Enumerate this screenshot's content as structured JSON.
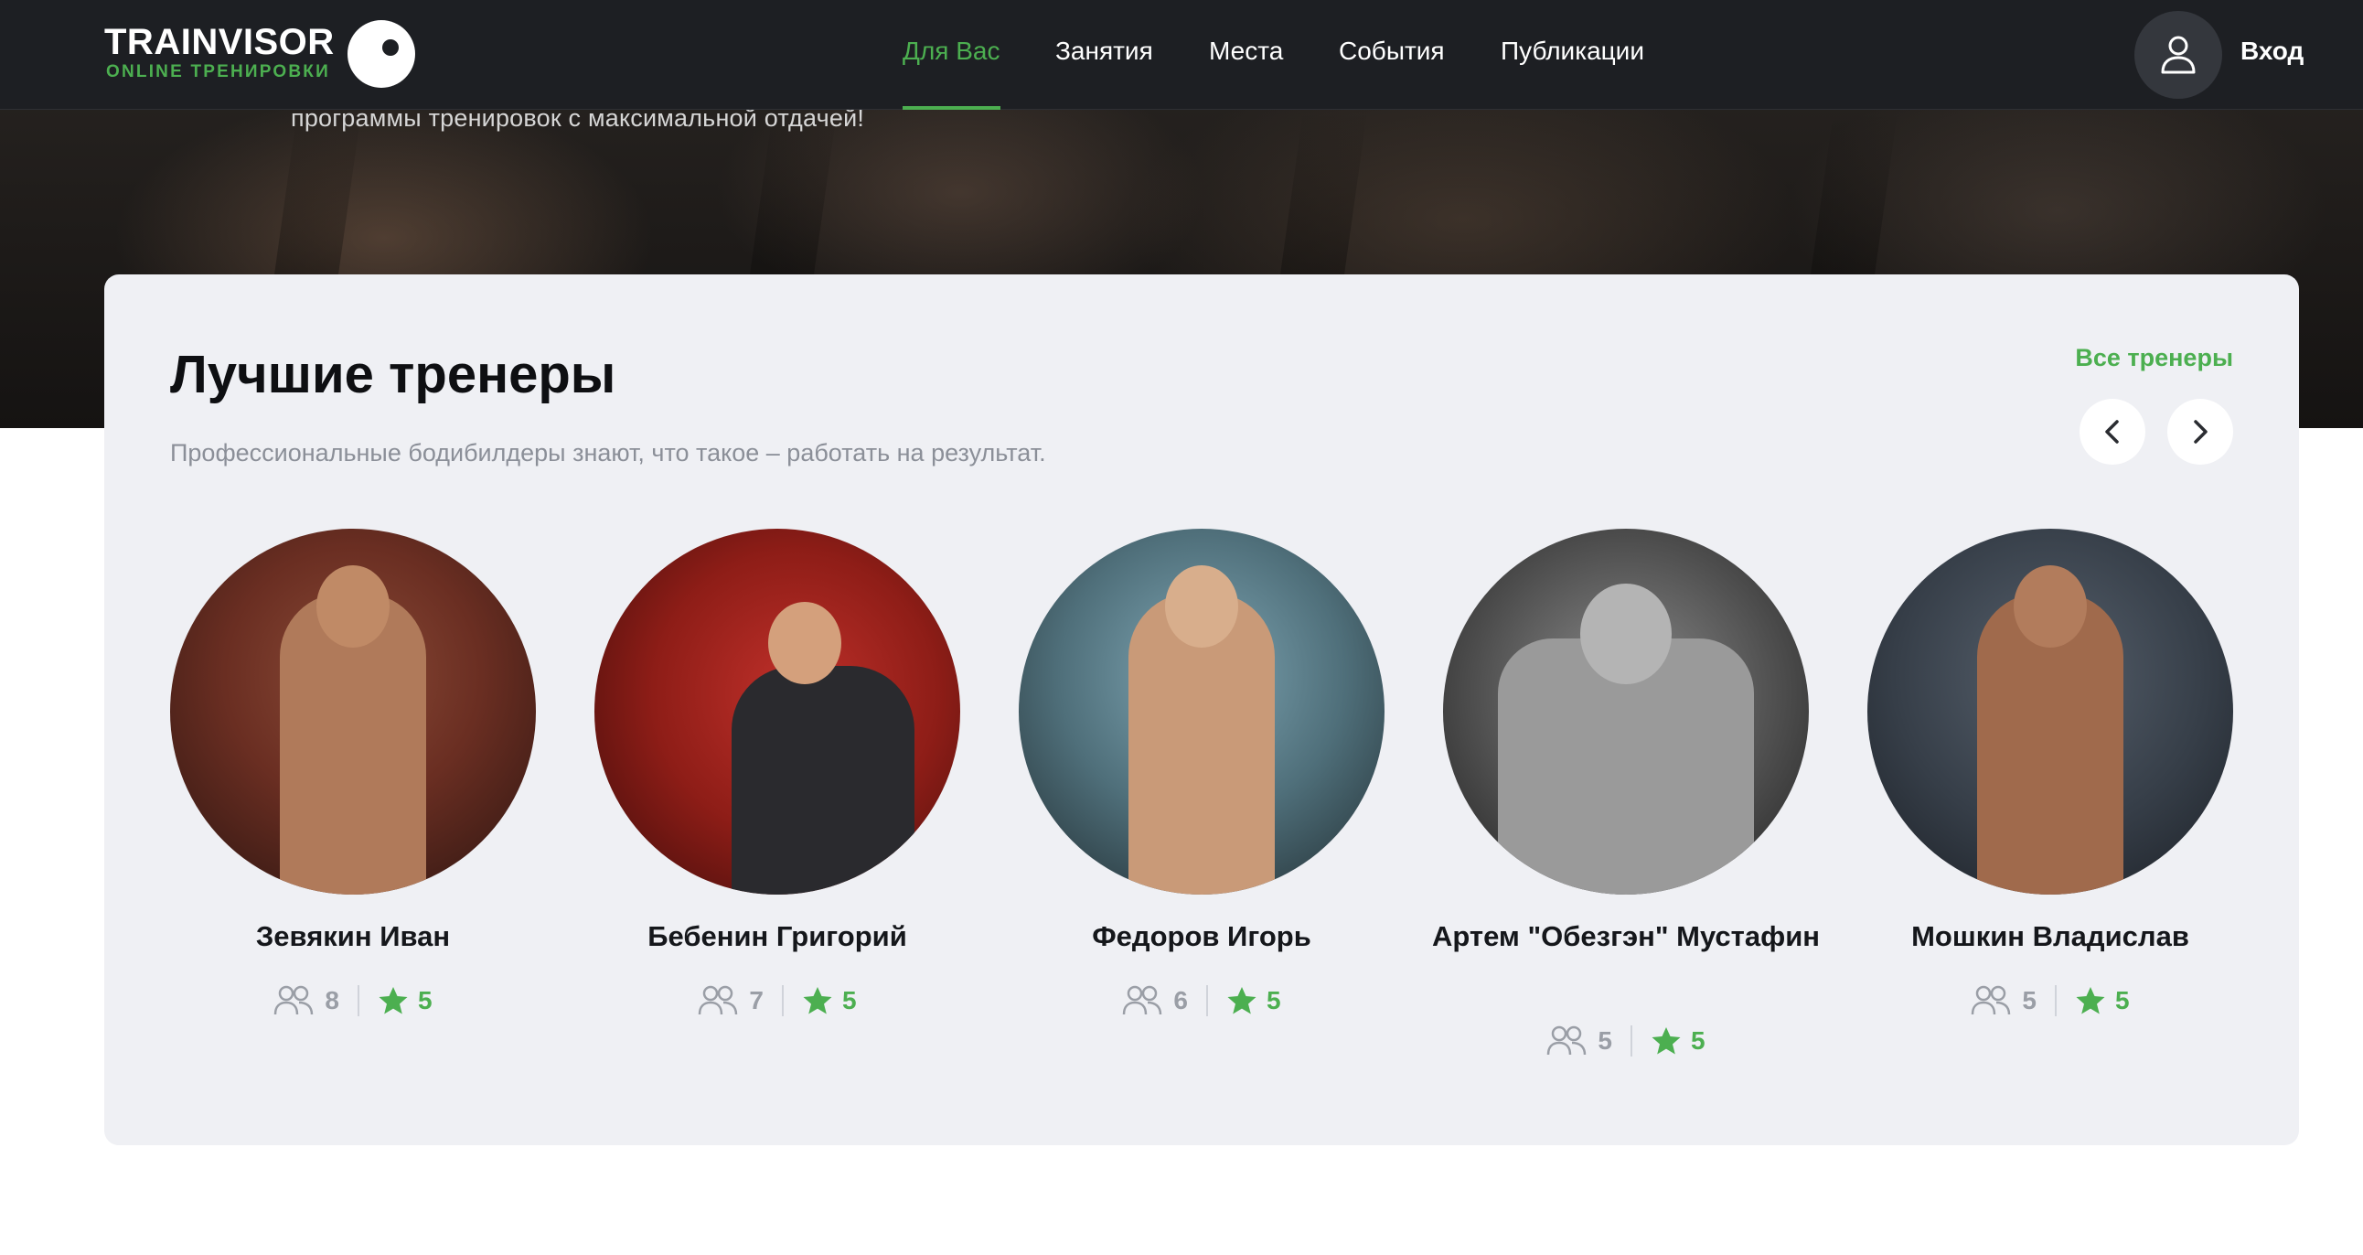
{
  "header": {
    "logo_title": "TRAINVISOR",
    "logo_subtitle": "ONLINE ТРЕНИРОВКИ",
    "nav": [
      {
        "label": "Для Вас",
        "active": true
      },
      {
        "label": "Занятия",
        "active": false
      },
      {
        "label": "Места",
        "active": false
      },
      {
        "label": "События",
        "active": false
      },
      {
        "label": "Публикации",
        "active": false
      }
    ],
    "login_label": "Вход",
    "login_icon": "user-icon"
  },
  "hero": {
    "text": "программы тренировок с максимальной отдачей!"
  },
  "trainers_section": {
    "title": "Лучшие тренеры",
    "subtitle": "Профессиональные бодибилдеры знают, что такое – работать на результат.",
    "all_link": "Все тренеры",
    "prev_icon": "chevron-left-icon",
    "next_icon": "chevron-right-icon",
    "trainers": [
      {
        "name": "Зевякин Иван",
        "students": "8",
        "rating": "5",
        "tone": "#7a3b2a"
      },
      {
        "name": "Бебенин Григорий",
        "students": "7",
        "rating": "5",
        "tone": "#a3261f"
      },
      {
        "name": "Федоров Игорь",
        "students": "6",
        "rating": "5",
        "tone": "#5c7b86"
      },
      {
        "name": "Артем \"Обезгэн\" Мустафин",
        "students": "5",
        "rating": "5",
        "tone": "#4a4a4a"
      },
      {
        "name": "Мошкин Владислав",
        "students": "5",
        "rating": "5",
        "tone": "#3a4450"
      }
    ]
  },
  "colors": {
    "accent": "#4caf50",
    "header_bg": "#1d1f23",
    "card_bg": "#eff0f4"
  }
}
